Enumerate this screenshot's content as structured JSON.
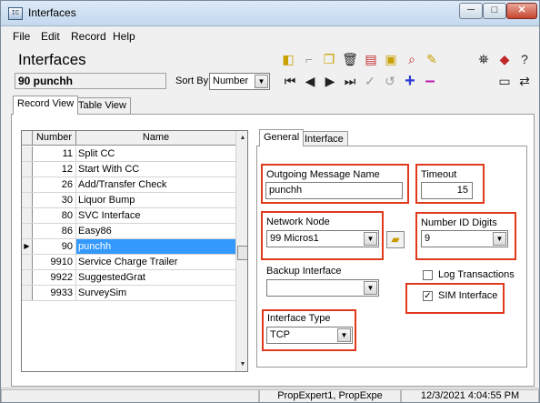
{
  "window": {
    "title": "Interfaces",
    "app_icon": "app-window-icon"
  },
  "controls": {
    "minimize": "─",
    "maximize": "□",
    "close": "✕"
  },
  "menu": [
    "File",
    "Edit",
    "Record",
    "Help"
  ],
  "header": {
    "title": "Interfaces",
    "record": "90 punchh",
    "sort_by_label": "Sort By",
    "sort_by_value": "Number"
  },
  "toolbar_icons": [
    "new-record-icon",
    "clear-icon",
    "copy-record-icon",
    "delete-icon",
    "report-icon",
    "properties-icon",
    "search-icon",
    "tools-icon",
    "find-icon",
    "bookmark-icon",
    "help-icon",
    "first-record-icon",
    "previous-record-icon",
    "next-record-icon",
    "last-record-icon",
    "confirm-icon",
    "undo-icon",
    "add-icon",
    "remove-icon",
    "monitor-icon",
    "network-icon"
  ],
  "tabs": {
    "record_view": "Record View",
    "table_view": "Table View"
  },
  "grid": {
    "columns": [
      "Number",
      "Name"
    ],
    "rows": [
      {
        "number": "11",
        "name": "Split CC"
      },
      {
        "number": "12",
        "name": "Start With CC"
      },
      {
        "number": "26",
        "name": "Add/Transfer Check"
      },
      {
        "number": "30",
        "name": "Liquor Bump"
      },
      {
        "number": "80",
        "name": "SVC Interface"
      },
      {
        "number": "86",
        "name": "Easy86"
      },
      {
        "number": "90",
        "name": "punchh"
      },
      {
        "number": "9910",
        "name": "Service Charge Trailer"
      },
      {
        "number": "9922",
        "name": "SuggestedGrat"
      },
      {
        "number": "9933",
        "name": "SurveySim"
      }
    ],
    "selected_index": 6,
    "row_marker": "▶"
  },
  "inner_tabs": {
    "general": "General",
    "interface": "Interface"
  },
  "form": {
    "outgoing_message_name_label": "Outgoing Message Name",
    "outgoing_message_name_value": "punchh",
    "timeout_label": "Timeout",
    "timeout_value": "15",
    "network_node_label": "Network Node",
    "network_node_value": "99  Micros1",
    "number_id_digits_label": "Number ID Digits",
    "number_id_digits_value": "9",
    "backup_interface_label": "Backup Interface",
    "backup_interface_value": "",
    "log_transactions_label": "Log Transactions",
    "log_transactions_checked": false,
    "sim_interface_label": "SIM Interface",
    "sim_interface_checked": true,
    "sim_interface_mark": "✓",
    "interface_type_label": "Interface Type",
    "interface_type_value": "TCP"
  },
  "status": {
    "user": "PropExpert1, PropExpe",
    "datetime": "12/3/2021 4:04:55 PM"
  },
  "colors": {
    "highlight_border": "#e03a1e",
    "selection": "#3399ff"
  }
}
